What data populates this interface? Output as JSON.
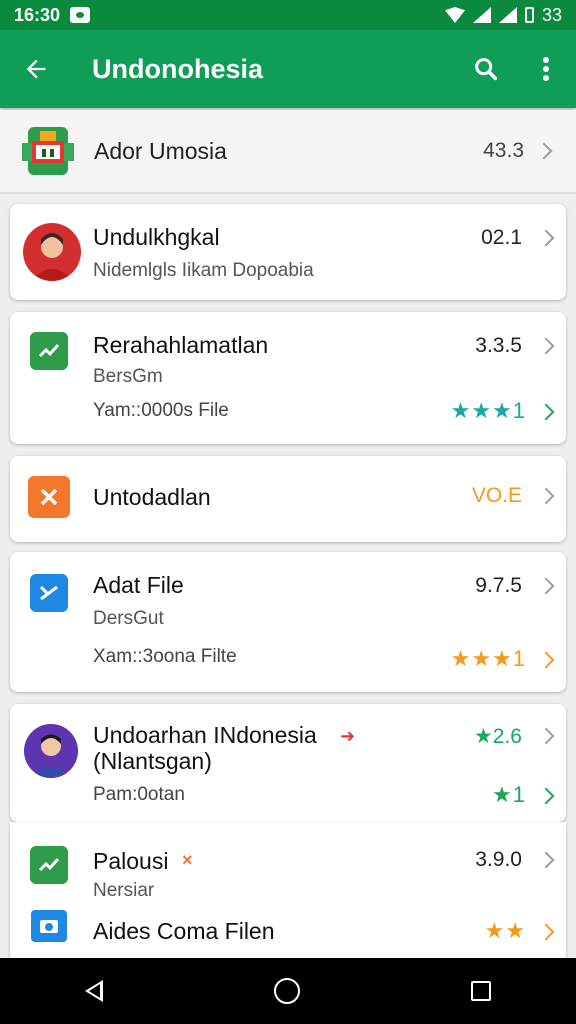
{
  "status": {
    "time": "16:30",
    "battery": "33"
  },
  "appbar": {
    "title": "Undonohesia"
  },
  "header": {
    "name": "Ador Umosia",
    "value": "43.3"
  },
  "cards": [
    {
      "title": "Undulkhgkal",
      "subtitle": "Nidemlgls Iikam Dopoabia",
      "value": "02.1"
    },
    {
      "title": "Rerahahlamatlan",
      "subtitle": "BersGm",
      "meta": "Yam::0000s File",
      "value": "3.3.5",
      "stars": "★★★1"
    },
    {
      "title": "Untodadlan",
      "value": "VO.E"
    },
    {
      "title": "Adat File",
      "subtitle": "DersGut",
      "meta": "Xam::3oona Filte",
      "value": "9.7.5",
      "stars": "★★★1"
    },
    {
      "title": "Undoarhan INdonesia",
      "title2": "(Nlantsgan)",
      "meta": "Pam:0otan",
      "value": "★2.6",
      "stars": "★1"
    },
    {
      "title": "Palousi",
      "subtitle": "Nersiar",
      "value": "3.9.0"
    },
    {
      "title": "Aides Coma Filen",
      "stars": "★★"
    }
  ],
  "colors": {
    "statusbar": "#0a8a3e",
    "appbar": "#0f9d58",
    "teal_star": "#1aa9a0",
    "orange_star": "#f39a1f",
    "green_star": "#1aa95a"
  }
}
